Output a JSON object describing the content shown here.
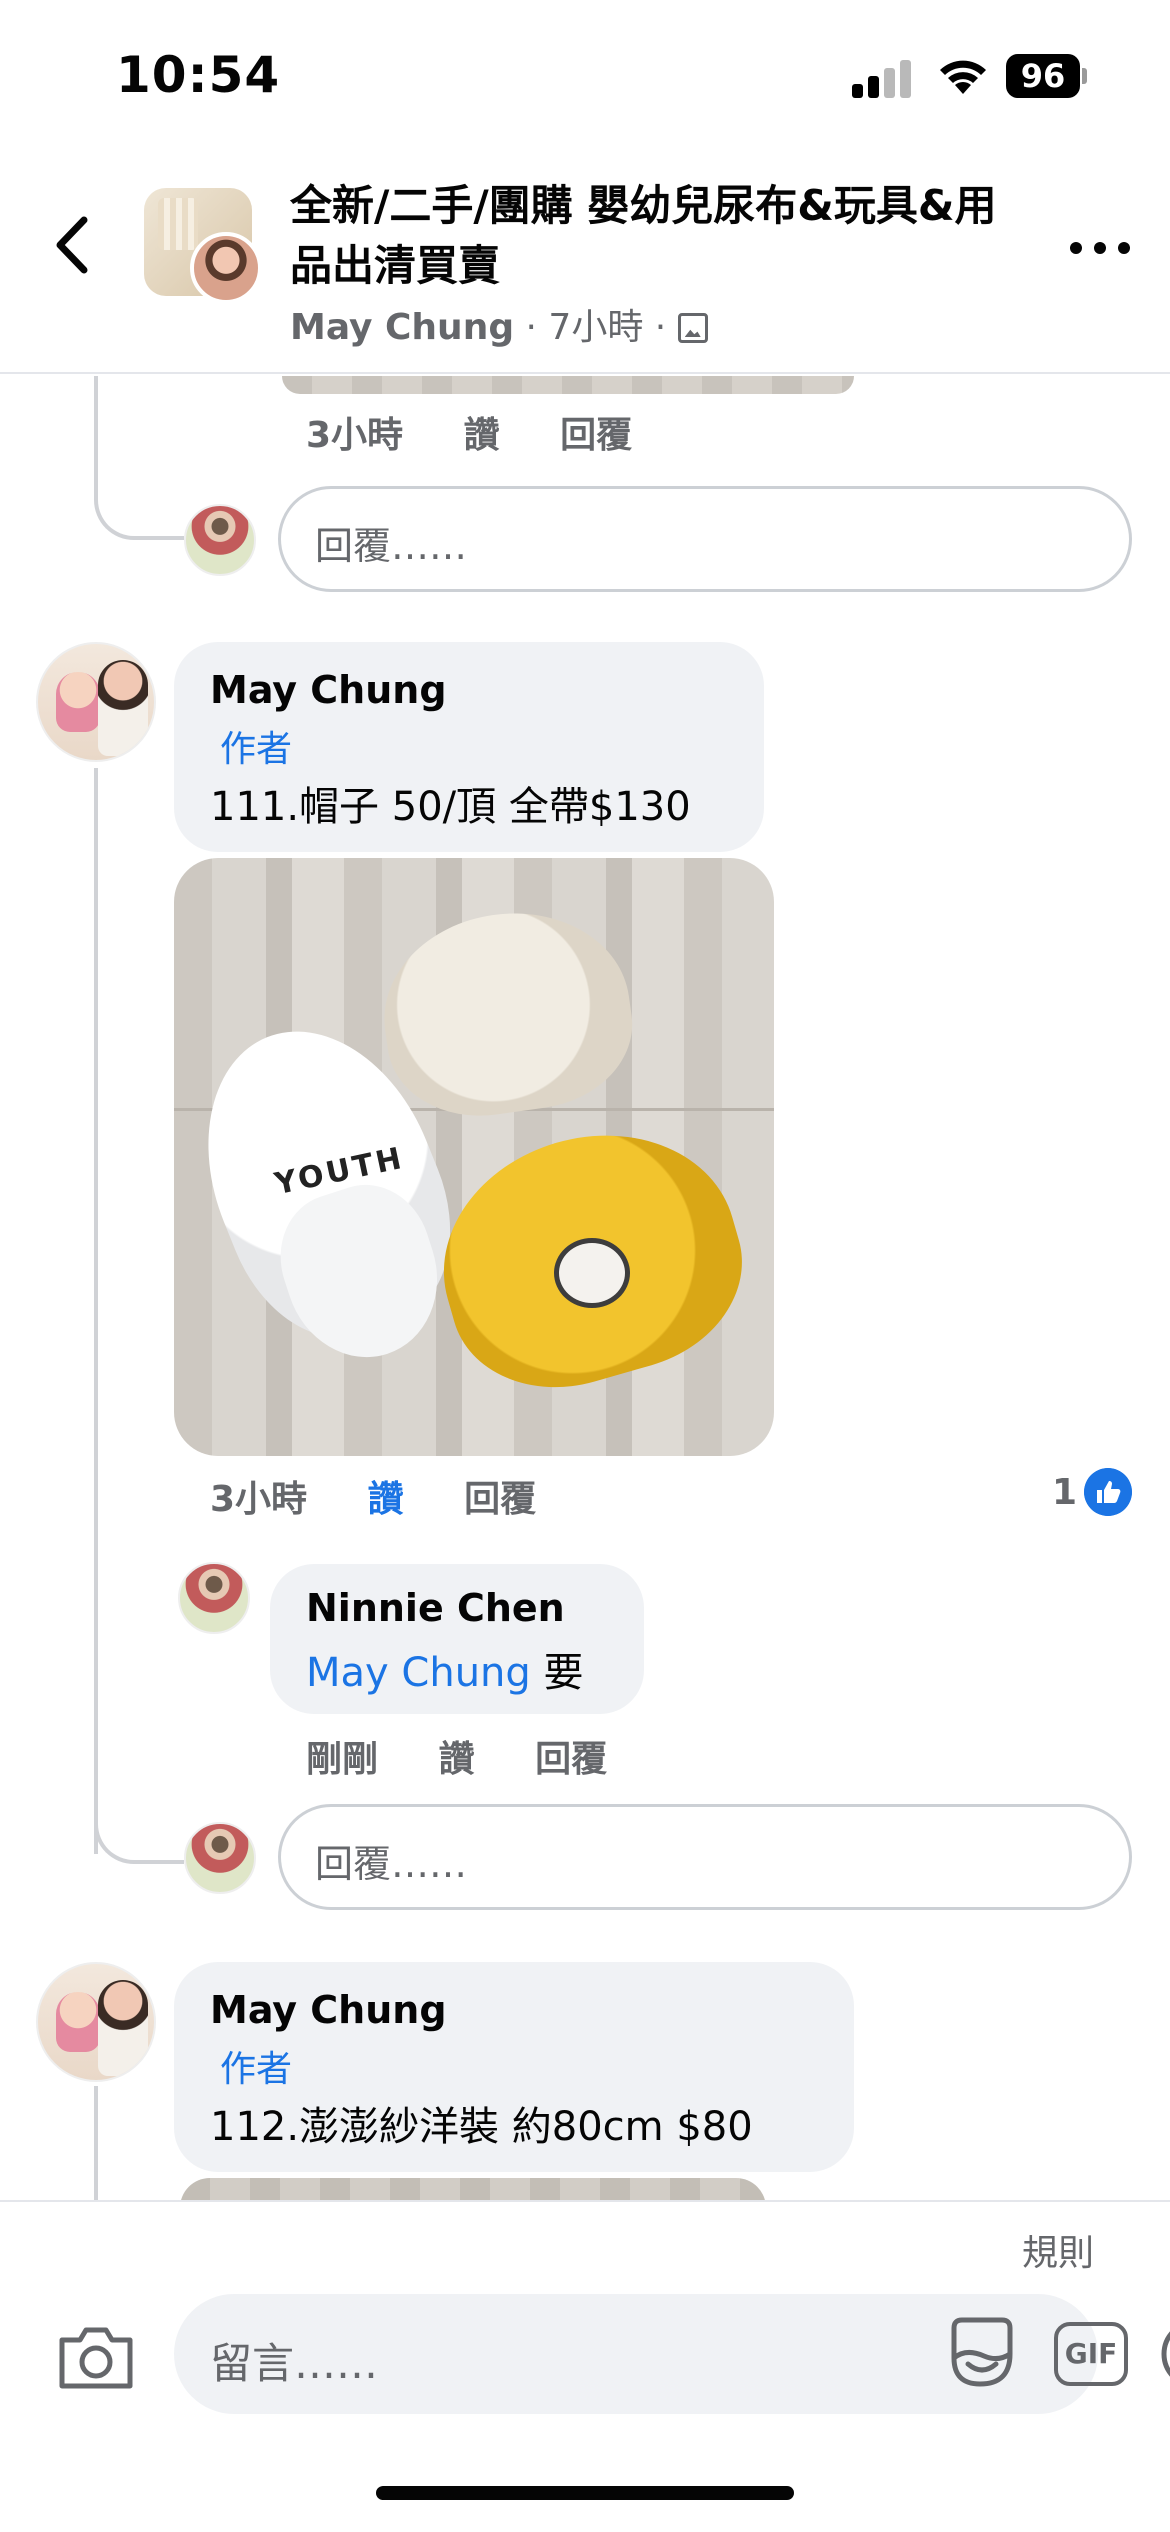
{
  "status_bar": {
    "time": "10:54",
    "battery": "96"
  },
  "header": {
    "title": "全新/二手/團購 嬰幼兒尿布&玩具&用品出清買賣",
    "author": "May Chung",
    "time_ago": "· 7小時 ·"
  },
  "previous_reply": {
    "actions": {
      "time": "3小時",
      "like": "讚",
      "reply": "回覆"
    },
    "reply_placeholder": "回覆……"
  },
  "comment_111": {
    "author": "May Chung",
    "badge": "作者",
    "text": "111.帽子 50/頂 全帶$130",
    "photo_text": "YOUTH",
    "actions": {
      "time": "3小時",
      "like": "讚",
      "reply": "回覆"
    },
    "like_count": "1",
    "reply": {
      "author": "Ninnie Chen",
      "mention": "May Chung",
      "text": " 要",
      "actions": {
        "time": "剛剛",
        "like": "讚",
        "reply": "回覆"
      }
    },
    "reply_placeholder": "回覆……"
  },
  "comment_112": {
    "author": "May Chung",
    "badge": "作者",
    "text": "112.澎澎紗洋裝 約80cm $80"
  },
  "composer": {
    "rules": "規則",
    "placeholder": "留言……",
    "gif_label": "GIF"
  },
  "colors": {
    "link_blue": "#1b74e4",
    "secondary_text": "#65676b",
    "bubble_bg": "#f0f2f5"
  }
}
